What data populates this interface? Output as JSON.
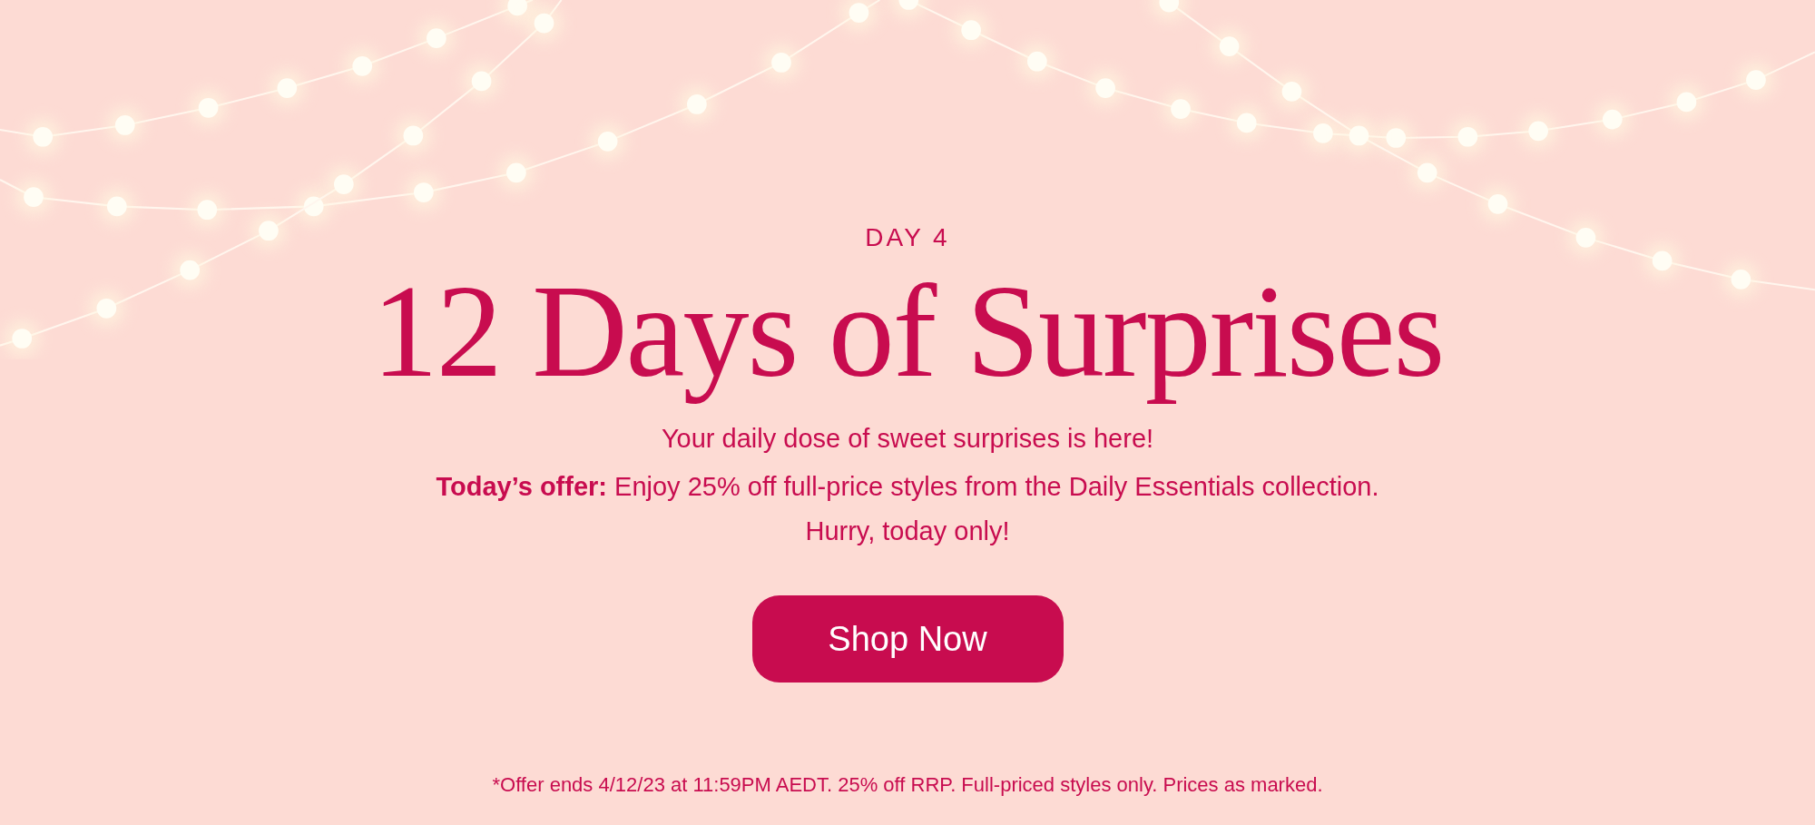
{
  "eyebrow": "DAY 4",
  "title": "12 Days of Surprises",
  "subtitle": "Your daily dose of sweet surprises is here!",
  "offer": "**Today’s offer:** Enjoy 25% off full-price styles from the Daily Essentials collection.",
  "closing": "Hurry, today only!",
  "button": {
    "label": "Shop Now"
  },
  "footnote": "*Offer ends 4/12/23 at 11:59PM AEDT. 25% off RRP. Full-priced styles only. Prices as marked."
}
